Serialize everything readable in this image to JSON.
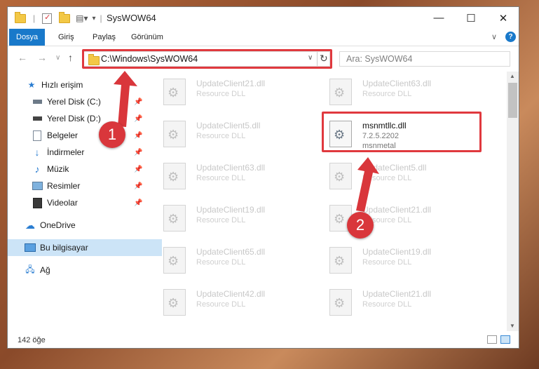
{
  "window": {
    "title": "SysWOW64",
    "buttons": {
      "minimize": "—",
      "maximize": "☐",
      "close": "✕"
    }
  },
  "ribbon": {
    "tabs": [
      "Dosya",
      "Giriş",
      "Paylaş",
      "Görünüm"
    ],
    "help": "?",
    "collapse": "∨"
  },
  "nav": {
    "address": "C:\\Windows\\SysWOW64",
    "search_placeholder": "Ara: SysWOW64"
  },
  "sidebar": {
    "items": [
      {
        "label": "Hızlı erişim",
        "icon": "star-icon"
      },
      {
        "label": "Yerel Disk (C:)",
        "icon": "drive-icon",
        "pinned": true
      },
      {
        "label": "Yerel Disk (D:)",
        "icon": "drive-icon",
        "pinned": true
      },
      {
        "label": "Belgeler",
        "icon": "documents-icon",
        "pinned": true
      },
      {
        "label": "İndirmeler",
        "icon": "download-icon",
        "pinned": true
      },
      {
        "label": "Müzik",
        "icon": "music-icon",
        "pinned": true
      },
      {
        "label": "Resimler",
        "icon": "pictures-icon",
        "pinned": true
      },
      {
        "label": "Videolar",
        "icon": "video-icon",
        "pinned": true
      },
      {
        "label": "OneDrive",
        "icon": "cloud-icon"
      },
      {
        "label": "Bu bilgisayar",
        "icon": "computer-icon",
        "selected": true
      },
      {
        "label": "Ağ",
        "icon": "network-icon"
      }
    ]
  },
  "files": [
    {
      "name": "UpdateClient21.dll",
      "desc": "Resource DLL"
    },
    {
      "name": "UpdateClient63.dll",
      "desc": "Resource DLL"
    },
    {
      "name": "UpdateClient5.dll",
      "desc": "Resource DLL"
    },
    {
      "name": "msnmtllc.dll",
      "version": "7.2.5.2202",
      "desc": "msnmetal",
      "focus": true
    },
    {
      "name": "UpdateClient63.dll",
      "desc": "Resource DLL"
    },
    {
      "name": "UpdateClient5.dll",
      "desc": "Resource DLL"
    },
    {
      "name": "UpdateClient19.dll",
      "desc": "Resource DLL"
    },
    {
      "name": "UpdateClient21.dll",
      "desc": "Resource DLL"
    },
    {
      "name": "UpdateClient65.dll",
      "desc": "Resource DLL"
    },
    {
      "name": "UpdateClient19.dll",
      "desc": "Resource DLL"
    },
    {
      "name": "UpdateClient42.dll",
      "desc": "Resource DLL"
    },
    {
      "name": "UpdateClient21.dll",
      "desc": "Resource DLL"
    }
  ],
  "status": {
    "count": "142 öğe"
  },
  "annotations": {
    "badge1": "1",
    "badge2": "2",
    "color": "#d9363b"
  }
}
